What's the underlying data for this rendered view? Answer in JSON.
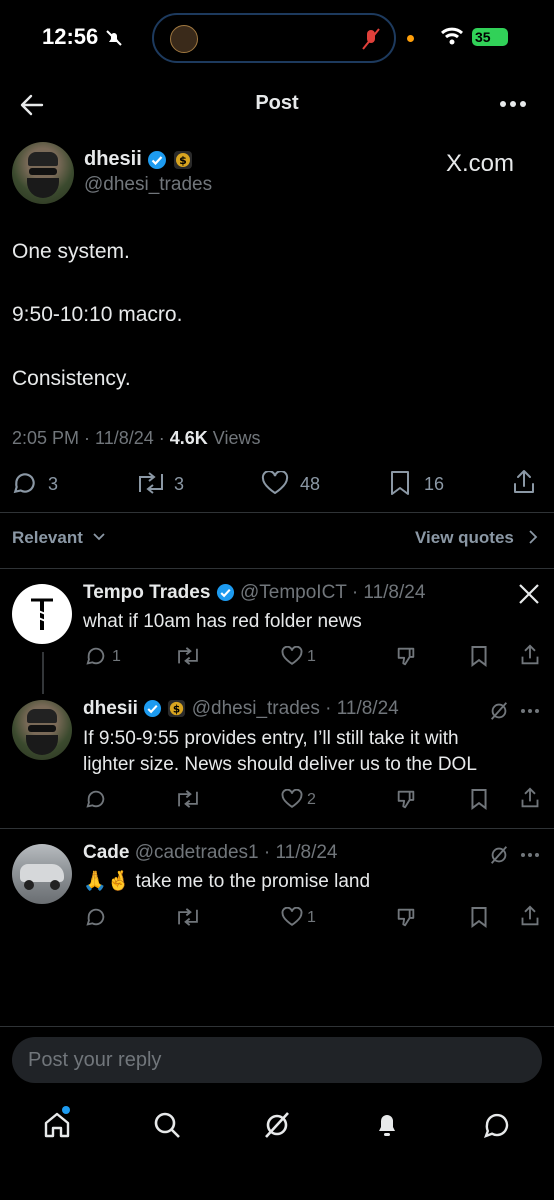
{
  "status_bar": {
    "time": "12:56",
    "battery": "35"
  },
  "header": {
    "title": "Post"
  },
  "post": {
    "author_name": "dhesii",
    "handle": "@dhesi_trades",
    "source_label": "X.com",
    "lines": [
      "One system.",
      "9:50-10:10 macro.",
      "Consistency."
    ],
    "timestamp": "2:05 PM · 11/8/24 · ",
    "views_count": "4.6K",
    "views_label": " Views",
    "replies": "3",
    "reposts": "3",
    "likes": "48",
    "bookmarks": "16"
  },
  "filter": {
    "relevant_label": "Relevant",
    "view_quotes_label": "View quotes"
  },
  "replies": [
    {
      "name": "Tempo Trades",
      "handle_date": "@TempoICT · 11/8/24",
      "text": "what if 10am has red folder news",
      "replies": "1",
      "likes": "1"
    },
    {
      "name": "dhesii",
      "handle_date": "@dhesi_trades · 11/8/24",
      "text_line1": "If 9:50-9:55 provides entry, I’ll still take it with",
      "text_line2": "lighter size. News should deliver us to the DOL",
      "likes": "2"
    },
    {
      "name": "Cade",
      "handle_date": "@cadetrades1 · 11/8/24",
      "emojis": "🙏🤞",
      "text": " take me to the promise land",
      "likes": "1"
    }
  ],
  "composer": {
    "placeholder": "Post your reply"
  },
  "colors": {
    "accent": "#1d9bf0",
    "background": "#000000",
    "muted": "#71767b"
  }
}
